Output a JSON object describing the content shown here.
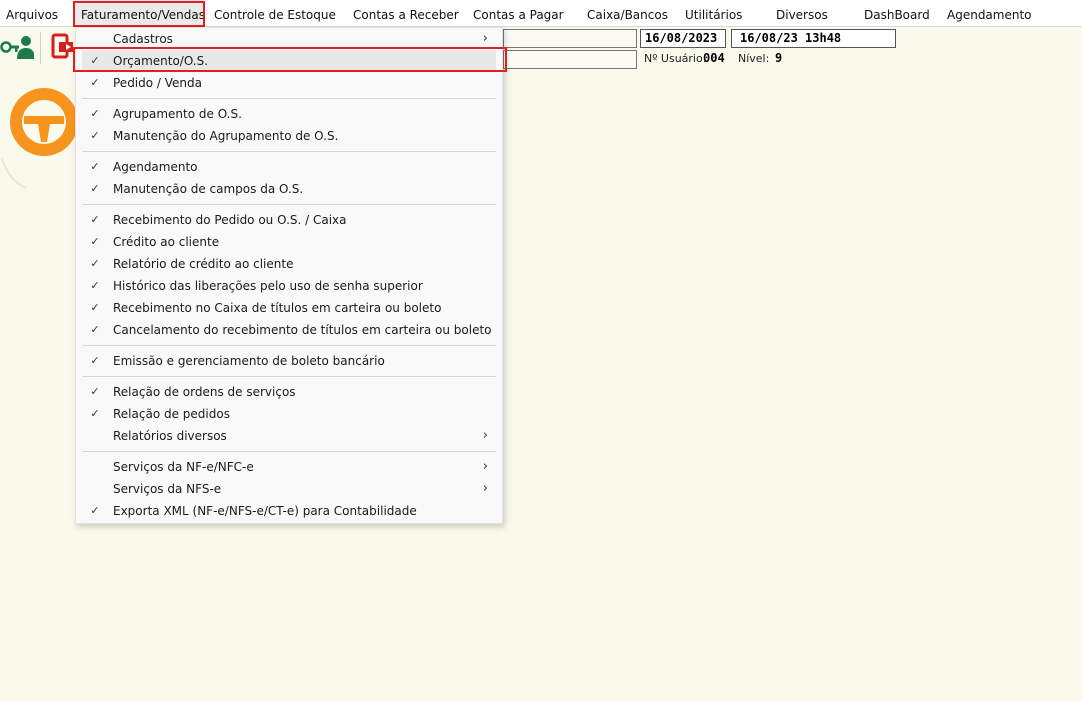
{
  "menubar": {
    "items": [
      {
        "label": "Arquivos",
        "name": "menu-arquivos"
      },
      {
        "label": "Faturamento/Vendas",
        "name": "menu-faturamento-vendas"
      },
      {
        "label": "Controle de Estoque",
        "name": "menu-controle-estoque"
      },
      {
        "label": "Contas a Receber",
        "name": "menu-contas-receber"
      },
      {
        "label": "Contas a Pagar",
        "name": "menu-contas-pagar"
      },
      {
        "label": "Caixa/Bancos",
        "name": "menu-caixa-bancos"
      },
      {
        "label": "Utilitários",
        "name": "menu-utilitarios"
      },
      {
        "label": "Diversos",
        "name": "menu-diversos"
      },
      {
        "label": "DashBoard",
        "name": "menu-dashboard"
      },
      {
        "label": "Agendamento",
        "name": "menu-agendamento"
      }
    ],
    "active": "Faturamento/Vendas"
  },
  "info_panel": {
    "date": "16/08/2023",
    "datetime": "16/08/23 13h48",
    "usuario_label": "Nº Usuário:",
    "usuario_value": "004",
    "nivel_label": "Nível:",
    "nivel_value": "9"
  },
  "dropdown": {
    "items": [
      {
        "label": "Cadastros",
        "checked": false,
        "submenu": true
      },
      {
        "label": "Orçamento/O.S.",
        "checked": true,
        "submenu": false,
        "highlighted": true
      },
      {
        "label": "Pedido / Venda",
        "checked": true,
        "submenu": false
      },
      {
        "label": "Agrupamento de O.S.",
        "checked": true,
        "submenu": false
      },
      {
        "label": "Manutenção do Agrupamento de O.S.",
        "checked": true,
        "submenu": false
      },
      {
        "label": "Agendamento",
        "checked": true,
        "submenu": false
      },
      {
        "label": "Manutenção de campos da O.S.",
        "checked": true,
        "submenu": false
      },
      {
        "label": "Recebimento do Pedido ou O.S. / Caixa",
        "checked": true,
        "submenu": false
      },
      {
        "label": "Crédito ao cliente",
        "checked": true,
        "submenu": false
      },
      {
        "label": "Relatório de crédito ao cliente",
        "checked": true,
        "submenu": false
      },
      {
        "label": "Histórico das liberações pelo uso de senha superior",
        "checked": true,
        "submenu": false
      },
      {
        "label": "Recebimento no Caixa de títulos em carteira ou boleto",
        "checked": true,
        "submenu": false
      },
      {
        "label": "Cancelamento do recebimento de títulos em carteira ou boleto",
        "checked": true,
        "submenu": false
      },
      {
        "label": "Emissão e gerenciamento de boleto bancário",
        "checked": true,
        "submenu": false
      },
      {
        "label": "Relação de ordens de serviços",
        "checked": true,
        "submenu": false
      },
      {
        "label": "Relação de pedidos",
        "checked": true,
        "submenu": false
      },
      {
        "label": "Relatórios diversos",
        "checked": false,
        "submenu": true
      },
      {
        "label": "Serviços da NF-e/NFC-e",
        "checked": false,
        "submenu": true
      },
      {
        "label": "Serviços da NFS-e",
        "checked": false,
        "submenu": true
      },
      {
        "label": "Exporta XML (NF-e/NFS-e/CT-e) para Contabilidade",
        "checked": true,
        "submenu": false
      }
    ],
    "check_glyph": "✓",
    "arrow_glyph": "›"
  },
  "colors": {
    "highlight_box": "#e02020",
    "logo_orange": "#f7941d",
    "key_icon_green": "#1f7a4a",
    "exit_icon_red": "#d62020"
  },
  "icons": {
    "toolbar_key": "key-user-icon",
    "toolbar_exit": "exit-icon",
    "logo": "steering-wheel-logo-icon"
  }
}
